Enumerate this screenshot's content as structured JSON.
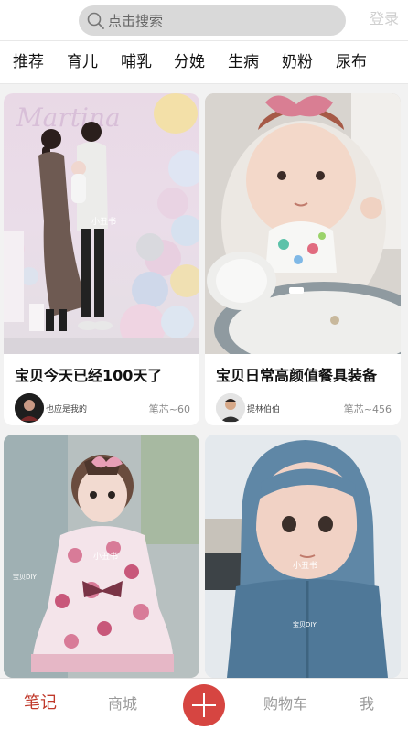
{
  "search": {
    "placeholder": "点击搜索"
  },
  "header": {
    "login_label": "登录"
  },
  "tabs": [
    "推荐",
    "育儿",
    "哺乳",
    "分娩",
    "生病",
    "奶粉",
    "尿布"
  ],
  "cards": [
    {
      "title": "宝贝今天已经100天了",
      "author": "也应是我的",
      "likes": "笔芯~60",
      "watermark": "小丑书",
      "photo_text": "Martina"
    },
    {
      "title": "宝贝日常高颜值餐具装备",
      "author": "提林伯伯",
      "likes": "笔芯~456"
    },
    {
      "title": "",
      "author": "",
      "likes": "",
      "watermark": "小丑书",
      "small_watermark": "宝贝DIY"
    },
    {
      "title": "",
      "author": "",
      "likes": "",
      "watermark": "小丑书",
      "small_watermark": "宝贝DIY"
    }
  ],
  "bottom_nav": {
    "notes": "笔记",
    "mall": "商城",
    "cart": "购物车",
    "me": "我"
  },
  "colors": {
    "accent": "#d64541",
    "active_tab_text": "#c0392b"
  }
}
